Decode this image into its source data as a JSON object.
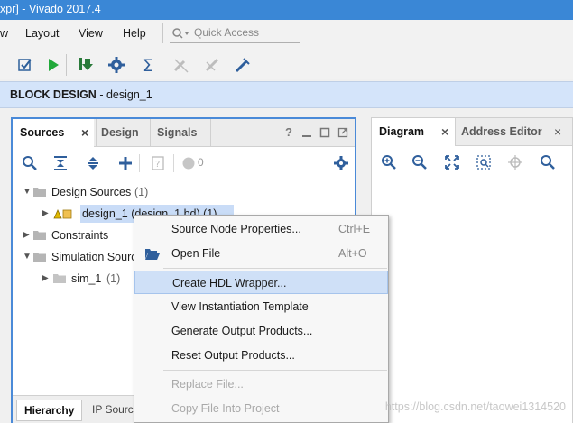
{
  "window": {
    "title": "xpr] - Vivado 2017.4"
  },
  "menu": {
    "items": [
      "w",
      "Layout",
      "View",
      "Help"
    ],
    "quick_access_placeholder": "Quick Access"
  },
  "toolbar": {
    "icons": [
      "checkbox-icon",
      "run-icon",
      "program-download-icon",
      "settings-gear-icon",
      "sigma-icon",
      "crossed-tool-icon-1",
      "crossed-tool-icon-2",
      "debug-tool-icon"
    ]
  },
  "block_design": {
    "label": "BLOCK DESIGN",
    "name": " - design_1"
  },
  "sources_panel": {
    "tabs": [
      "Sources",
      "Design",
      "Signals"
    ],
    "close_glyph": "×",
    "help_glyph": "?",
    "badge_count": "0",
    "tree": {
      "design_sources": {
        "label": "Design Sources",
        "count": "(1)"
      },
      "design_1": {
        "label": "design_1 (design_1.bd) (1)"
      },
      "constraints": {
        "label": "Constraints"
      },
      "simulation_sources": {
        "label": "Simulation Sources"
      },
      "sim_1": {
        "label": "sim_1",
        "count": "(1)"
      }
    },
    "bottom_tabs": [
      "Hierarchy",
      "IP Sources"
    ]
  },
  "diagram_panel": {
    "tabs": [
      "Diagram",
      "Address Editor"
    ]
  },
  "context_menu": {
    "items": [
      {
        "label": "Source Node Properties...",
        "shortcut": "Ctrl+E"
      },
      {
        "label": "Open File",
        "shortcut": "Alt+O"
      },
      {
        "label": "Create HDL Wrapper..."
      },
      {
        "label": "View Instantiation Template"
      },
      {
        "label": "Generate Output Products..."
      },
      {
        "label": "Reset Output Products..."
      },
      {
        "label": "Replace File..."
      },
      {
        "label": "Copy File Into Project"
      }
    ]
  },
  "watermark": "https://blog.csdn.net/taowei1314520",
  "colors": {
    "title_bar": "#3a87d6",
    "panel_border": "#4a8ad8",
    "header_bg": "#d4e4fa",
    "selection": "#c9dcf7"
  }
}
